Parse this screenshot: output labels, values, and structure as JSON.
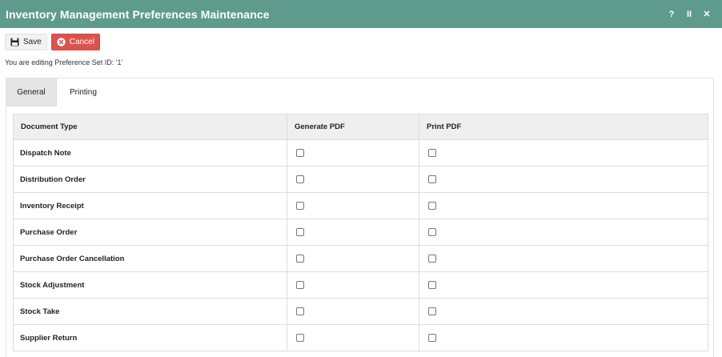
{
  "window": {
    "title": "Inventory Management Preferences Maintenance",
    "controls": {
      "help": "?",
      "pause": "II",
      "close": "✕"
    }
  },
  "toolbar": {
    "save_label": "Save",
    "cancel_label": "Cancel"
  },
  "edit_message": "You are editing Preference Set ID: '1'",
  "tabs": [
    {
      "label": "General",
      "active": true
    },
    {
      "label": "Printing",
      "active": false
    }
  ],
  "table": {
    "headers": [
      "Document Type",
      "Generate PDF",
      "Print PDF"
    ],
    "rows": [
      {
        "document_type": "Dispatch Note",
        "generate_pdf": false,
        "print_pdf": false
      },
      {
        "document_type": "Distribution Order",
        "generate_pdf": false,
        "print_pdf": false
      },
      {
        "document_type": "Inventory Receipt",
        "generate_pdf": false,
        "print_pdf": false
      },
      {
        "document_type": "Purchase Order",
        "generate_pdf": false,
        "print_pdf": false
      },
      {
        "document_type": "Purchase Order Cancellation",
        "generate_pdf": false,
        "print_pdf": false
      },
      {
        "document_type": "Stock Adjustment",
        "generate_pdf": false,
        "print_pdf": false
      },
      {
        "document_type": "Stock Take",
        "generate_pdf": false,
        "print_pdf": false
      },
      {
        "document_type": "Supplier Return",
        "generate_pdf": false,
        "print_pdf": false
      }
    ]
  },
  "icons": {
    "save": "floppy-disk-icon",
    "cancel": "circle-x-icon"
  },
  "colors": {
    "titlebar": "#5f9b8c",
    "cancel_button": "#d9534f",
    "header_bg": "#efefef",
    "active_tab_bg": "#e5e5e5"
  }
}
